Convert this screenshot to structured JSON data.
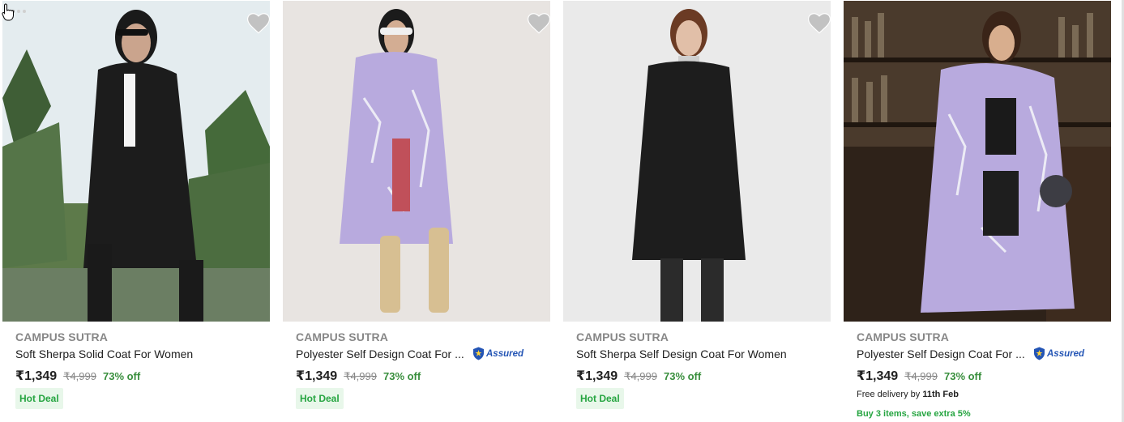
{
  "products": [
    {
      "brand": "CAMPUS SUTRA",
      "title": "Soft Sherpa Solid Coat For Women",
      "price": "₹1,349",
      "mrp": "₹4,999",
      "discount": "73% off",
      "badge": "Hot Deal",
      "assured": false,
      "image": "woman-black-coat-palm-trees",
      "coat_color": "#1c1c1c",
      "bg_color": "#dfe9ee"
    },
    {
      "brand": "CAMPUS SUTRA",
      "title": "Polyester Self Design Coat For ...",
      "price": "₹1,349",
      "mrp": "₹4,999",
      "discount": "73% off",
      "badge": "Hot Deal",
      "assured": true,
      "assured_label": "Assured",
      "image": "woman-lavender-coat-studio",
      "coat_color": "#b7a8dc",
      "bg_color": "#e9e6e4"
    },
    {
      "brand": "CAMPUS SUTRA",
      "title": "Soft Sherpa Self Design Coat For Women",
      "price": "₹1,349",
      "mrp": "₹4,999",
      "discount": "73% off",
      "badge": "Hot Deal",
      "assured": false,
      "image": "woman-black-coat-studio",
      "coat_color": "#1e1e1e",
      "bg_color": "#ececec"
    },
    {
      "brand": "CAMPUS SUTRA",
      "title": "Polyester Self Design Coat For ...",
      "price": "₹1,349",
      "mrp": "₹4,999",
      "discount": "73% off",
      "assured": true,
      "assured_label": "Assured",
      "delivery_prefix": "Free delivery by",
      "delivery_date": "11th Feb",
      "offer": "Buy 3 items, save extra 5%",
      "image": "woman-lavender-coat-bar",
      "coat_color": "#b7a8dc",
      "bg_color": "#3a2a20"
    }
  ],
  "icons": {
    "wishlist": "heart-icon",
    "assured": "shield-icon",
    "cursor": "hand-pointer-icon"
  },
  "colors": {
    "price_green": "#388e3c",
    "hot_deal_bg": "#e8f7ea",
    "hot_deal_text": "#26a541",
    "assured_blue": "#2455b5"
  }
}
